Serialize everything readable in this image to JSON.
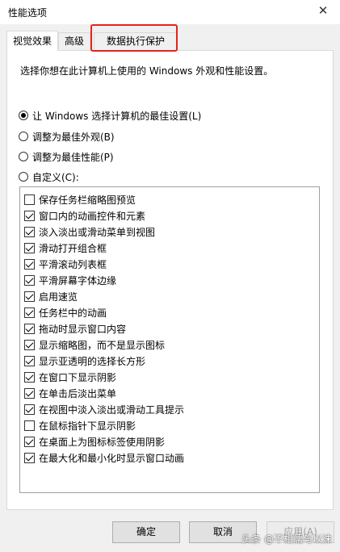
{
  "window": {
    "title": "性能选项",
    "close_glyph": "✕"
  },
  "tabs": [
    {
      "label": "视觉效果",
      "active": true
    },
    {
      "label": "高级",
      "active": false
    },
    {
      "label": "数据执行保护",
      "active": false,
      "highlighted": true
    }
  ],
  "description": "选择你想在此计算机上使用的 Windows 外观和性能设置。",
  "radios": [
    {
      "label": "让 Windows 选择计算机的最佳设置(L)",
      "checked": true
    },
    {
      "label": "调整为最佳外观(B)",
      "checked": false
    },
    {
      "label": "调整为最佳性能(P)",
      "checked": false
    },
    {
      "label": "自定义(C):",
      "checked": false
    }
  ],
  "options": [
    {
      "label": "保存任务栏缩略图预览",
      "checked": false
    },
    {
      "label": "窗口内的动画控件和元素",
      "checked": true
    },
    {
      "label": "淡入淡出或滑动菜单到视图",
      "checked": true
    },
    {
      "label": "滑动打开组合框",
      "checked": true
    },
    {
      "label": "平滑滚动列表框",
      "checked": true
    },
    {
      "label": "平滑屏幕字体边缘",
      "checked": true
    },
    {
      "label": "启用速览",
      "checked": true
    },
    {
      "label": "任务栏中的动画",
      "checked": true
    },
    {
      "label": "拖动时显示窗口内容",
      "checked": true
    },
    {
      "label": "显示缩略图，而不是显示图标",
      "checked": true
    },
    {
      "label": "显示亚透明的选择长方形",
      "checked": true
    },
    {
      "label": "在窗口下显示阴影",
      "checked": true
    },
    {
      "label": "在单击后淡出菜单",
      "checked": true
    },
    {
      "label": "在视图中淡入淡出或滑动工具提示",
      "checked": true
    },
    {
      "label": "在鼠标指针下显示阴影",
      "checked": false
    },
    {
      "label": "在桌面上为图标标签使用阴影",
      "checked": true
    },
    {
      "label": "在最大化和最小化时显示窗口动画",
      "checked": true
    }
  ],
  "buttons": {
    "ok": "确定",
    "cancel": "取消",
    "apply": "应用(A)"
  },
  "watermark": "头条 @不相濡与以沫",
  "colors": {
    "highlight": "#e5231d"
  }
}
